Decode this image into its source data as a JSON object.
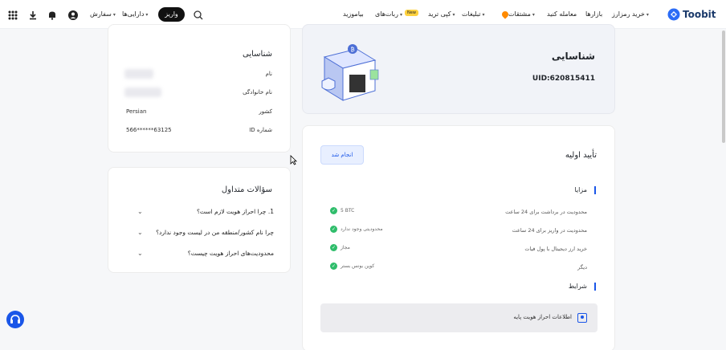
{
  "header": {
    "brand": "Toobit",
    "nav": [
      {
        "label": "خرید رمزارز",
        "caret": true
      },
      {
        "label": "بازارها",
        "caret": false
      },
      {
        "label": "معامله کنید",
        "caret": false
      },
      {
        "label": "مشتقات",
        "caret": true
      },
      {
        "label": "تبلیغات",
        "caret": true
      },
      {
        "label": "کپی ترید",
        "caret": true
      },
      {
        "label": "ربات‌های",
        "caret": true
      },
      {
        "label": "بیاموزید",
        "caret": false
      }
    ],
    "new_badge": "New",
    "deposit_label": "واریز",
    "assets_label": "دارایی‌ها",
    "orders_label": "سفارش"
  },
  "identity_card": {
    "title": "شناسایی",
    "uid": "UID:620815411"
  },
  "identity_info": {
    "title": "شناسایی",
    "fields": [
      {
        "label": "نام",
        "value": ""
      },
      {
        "label": "نام خانوادگی",
        "value": ""
      },
      {
        "label": "کشور",
        "value": "Persian"
      },
      {
        "label": "شماره ID",
        "value": "566******63125"
      }
    ]
  },
  "basic_verification": {
    "title": "تأیید اولیه",
    "status": "انجام شد",
    "benefits_title": "مزایا",
    "benefits": [
      {
        "label": "محدودیت در برداشت برای 24 ساعت",
        "value": "5 BTC"
      },
      {
        "label": "محدودیت در واریز برای 24 ساعت",
        "value": "محدودیتی وجود ندارد"
      },
      {
        "label": "خرید ارز دیجیتال با پول فیات",
        "value": "مجاز"
      },
      {
        "label": "دیگر",
        "value": "کوپن بونس بستر"
      }
    ],
    "requirements_title": "شرایط",
    "requirement_item": "اطلاعات احراز هویت پایه"
  },
  "faq": {
    "title": "سؤالات متداول",
    "items": [
      "1. چرا احراز هویت لازم است؟",
      "چرا نام کشور/منطقه من در لیست وجود ندارد؟",
      "محدودیت‌های احراز هویت چیست؟"
    ]
  },
  "colors": {
    "accent": "#1a56e8",
    "success": "#2fbd6b",
    "brand": "#1b3a6b"
  }
}
